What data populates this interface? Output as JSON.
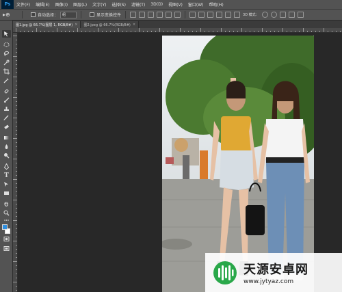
{
  "menubar": {
    "logo": "Ps",
    "items": [
      "文件(F)",
      "编辑(E)",
      "图像(I)",
      "图层(L)",
      "文字(Y)",
      "选择(S)",
      "滤镜(T)",
      "3D(D)",
      "视图(V)",
      "窗口(W)",
      "帮助(H)"
    ]
  },
  "options": {
    "tool_glyph": "▸⊕",
    "auto_select_label": "自动选择：",
    "auto_select_value": "组",
    "show_transform_label": "显示变换控件",
    "mode_label": "3D 模式："
  },
  "tabs": [
    {
      "label": "图1.jpg @ 66.7%(图层 1, RGB/8#)",
      "close": "×"
    },
    {
      "label": "图2.jpeg @ 66.7%(RGB/8#)",
      "close": "×"
    }
  ],
  "watermark": {
    "title": "天源安卓网",
    "url": "www.jytyaz.com"
  },
  "colors": {
    "chrome": "#535353",
    "canvas": "#282828",
    "foreground": "#2f8fe0",
    "background": "#ffffff",
    "watermark_green": "#2aa84a"
  }
}
